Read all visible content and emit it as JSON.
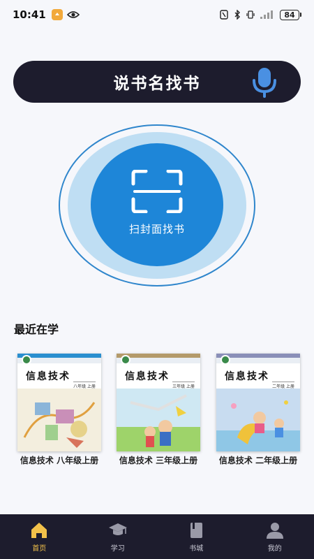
{
  "status_bar": {
    "time": "10:41",
    "battery": "84"
  },
  "search": {
    "voice_label": "说书名找书"
  },
  "scan": {
    "label": "扫封面找书"
  },
  "recent": {
    "title": "最近在学",
    "books": [
      {
        "title": "信息技术 八年级上册",
        "cover_title": "信息技术",
        "cover_grade": "八年级 上册",
        "accent": "#2a8fcf"
      },
      {
        "title": "信息技术 三年级上册",
        "cover_title": "信息技术",
        "cover_grade": "三年级 上册",
        "accent": "#b49a6a"
      },
      {
        "title": "信息技术 二年级上册",
        "cover_title": "信息技术",
        "cover_grade": "二年级 上册",
        "accent": "#8a8fb8"
      }
    ]
  },
  "nav": {
    "items": [
      {
        "label": "首页",
        "icon": "home-icon",
        "active": true
      },
      {
        "label": "学习",
        "icon": "graduation-cap-icon",
        "active": false
      },
      {
        "label": "书城",
        "icon": "book-icon",
        "active": false
      },
      {
        "label": "我的",
        "icon": "user-icon",
        "active": false
      }
    ]
  },
  "colors": {
    "dark": "#1d1c2d",
    "primary_blue": "#1e86d8",
    "light_blue": "#bfdef3",
    "active_nav": "#f2c14a"
  }
}
